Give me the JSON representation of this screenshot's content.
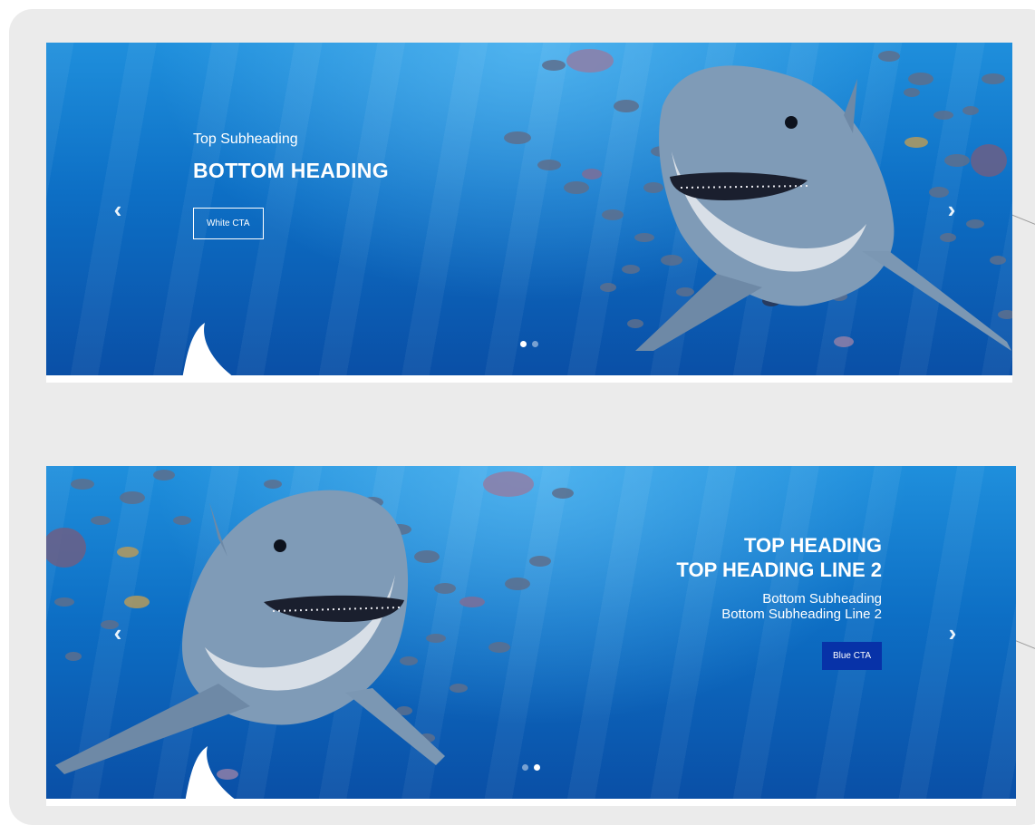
{
  "banners": [
    {
      "subheading": "Top Subheading",
      "heading": "BOTTOM HEADING",
      "cta_label": "White CTA"
    },
    {
      "heading_line1": "TOP HEADING",
      "heading_line2": "TOP HEADING LINE 2",
      "subheading_line1": "Bottom Subheading",
      "subheading_line2": "Bottom Subheading Line 2",
      "cta_label": "Blue CTA"
    }
  ],
  "nav": {
    "prev_glyph": "‹",
    "next_glyph": "›"
  },
  "colors": {
    "panel": "#ebebeb",
    "ocean_top": "#1f8fdc",
    "ocean_bottom": "#0a4fa6",
    "blue_cta": "#0732a8",
    "white": "#ffffff"
  },
  "icons": [
    "chevron-left-icon",
    "chevron-right-icon",
    "carousel-dot"
  ]
}
